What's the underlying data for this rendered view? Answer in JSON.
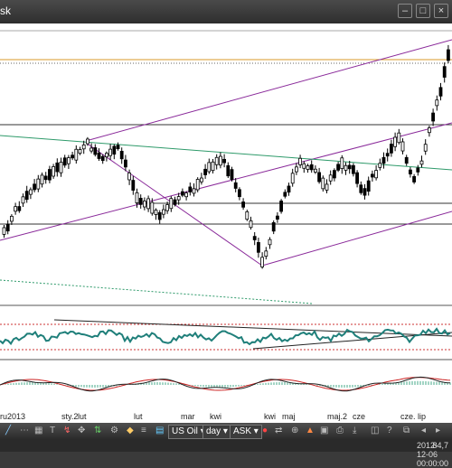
{
  "window": {
    "title": "sk"
  },
  "chart": {
    "x_labels": [
      "ru2013",
      "sty.2",
      "lut",
      "lut",
      "mar",
      "kwi",
      "kwi",
      "maj",
      "maj.2",
      "cze",
      "cze.",
      "lip"
    ],
    "colors": {
      "up_candle": "#ffffff",
      "down_candle": "#000000",
      "channel": "#8a2a9a",
      "trend": "#2e9a6a",
      "level": "#d99a2a",
      "oscillator": "#1f7f7a"
    }
  },
  "toolbar": {
    "instrument_label": "US Oil",
    "interval_label": "day",
    "price_type_label": "ASK",
    "dropdown_arrow": "▾"
  },
  "status": {
    "datetime": "2012-12-06 00:00:00",
    "value": "84,7"
  }
}
